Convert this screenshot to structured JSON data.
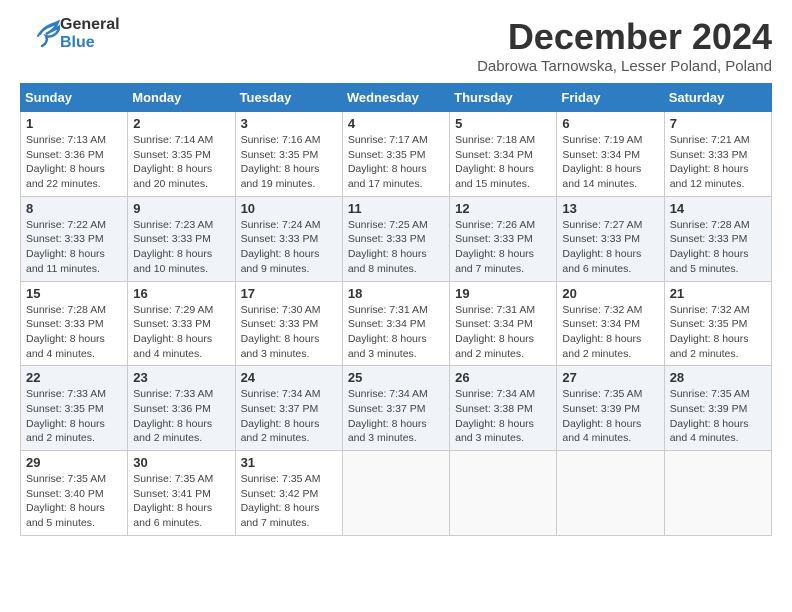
{
  "header": {
    "logo_general": "General",
    "logo_blue": "Blue",
    "month_title": "December 2024",
    "subtitle": "Dabrowa Tarnowska, Lesser Poland, Poland"
  },
  "days_of_week": [
    "Sunday",
    "Monday",
    "Tuesday",
    "Wednesday",
    "Thursday",
    "Friday",
    "Saturday"
  ],
  "weeks": [
    [
      {
        "day": "1",
        "sunrise": "7:13 AM",
        "sunset": "3:36 PM",
        "daylight": "8 hours and 22 minutes."
      },
      {
        "day": "2",
        "sunrise": "7:14 AM",
        "sunset": "3:35 PM",
        "daylight": "8 hours and 20 minutes."
      },
      {
        "day": "3",
        "sunrise": "7:16 AM",
        "sunset": "3:35 PM",
        "daylight": "8 hours and 19 minutes."
      },
      {
        "day": "4",
        "sunrise": "7:17 AM",
        "sunset": "3:35 PM",
        "daylight": "8 hours and 17 minutes."
      },
      {
        "day": "5",
        "sunrise": "7:18 AM",
        "sunset": "3:34 PM",
        "daylight": "8 hours and 15 minutes."
      },
      {
        "day": "6",
        "sunrise": "7:19 AM",
        "sunset": "3:34 PM",
        "daylight": "8 hours and 14 minutes."
      },
      {
        "day": "7",
        "sunrise": "7:21 AM",
        "sunset": "3:33 PM",
        "daylight": "8 hours and 12 minutes."
      }
    ],
    [
      {
        "day": "8",
        "sunrise": "7:22 AM",
        "sunset": "3:33 PM",
        "daylight": "8 hours and 11 minutes."
      },
      {
        "day": "9",
        "sunrise": "7:23 AM",
        "sunset": "3:33 PM",
        "daylight": "8 hours and 10 minutes."
      },
      {
        "day": "10",
        "sunrise": "7:24 AM",
        "sunset": "3:33 PM",
        "daylight": "8 hours and 9 minutes."
      },
      {
        "day": "11",
        "sunrise": "7:25 AM",
        "sunset": "3:33 PM",
        "daylight": "8 hours and 8 minutes."
      },
      {
        "day": "12",
        "sunrise": "7:26 AM",
        "sunset": "3:33 PM",
        "daylight": "8 hours and 7 minutes."
      },
      {
        "day": "13",
        "sunrise": "7:27 AM",
        "sunset": "3:33 PM",
        "daylight": "8 hours and 6 minutes."
      },
      {
        "day": "14",
        "sunrise": "7:28 AM",
        "sunset": "3:33 PM",
        "daylight": "8 hours and 5 minutes."
      }
    ],
    [
      {
        "day": "15",
        "sunrise": "7:28 AM",
        "sunset": "3:33 PM",
        "daylight": "8 hours and 4 minutes."
      },
      {
        "day": "16",
        "sunrise": "7:29 AM",
        "sunset": "3:33 PM",
        "daylight": "8 hours and 4 minutes."
      },
      {
        "day": "17",
        "sunrise": "7:30 AM",
        "sunset": "3:33 PM",
        "daylight": "8 hours and 3 minutes."
      },
      {
        "day": "18",
        "sunrise": "7:31 AM",
        "sunset": "3:34 PM",
        "daylight": "8 hours and 3 minutes."
      },
      {
        "day": "19",
        "sunrise": "7:31 AM",
        "sunset": "3:34 PM",
        "daylight": "8 hours and 2 minutes."
      },
      {
        "day": "20",
        "sunrise": "7:32 AM",
        "sunset": "3:34 PM",
        "daylight": "8 hours and 2 minutes."
      },
      {
        "day": "21",
        "sunrise": "7:32 AM",
        "sunset": "3:35 PM",
        "daylight": "8 hours and 2 minutes."
      }
    ],
    [
      {
        "day": "22",
        "sunrise": "7:33 AM",
        "sunset": "3:35 PM",
        "daylight": "8 hours and 2 minutes."
      },
      {
        "day": "23",
        "sunrise": "7:33 AM",
        "sunset": "3:36 PM",
        "daylight": "8 hours and 2 minutes."
      },
      {
        "day": "24",
        "sunrise": "7:34 AM",
        "sunset": "3:37 PM",
        "daylight": "8 hours and 2 minutes."
      },
      {
        "day": "25",
        "sunrise": "7:34 AM",
        "sunset": "3:37 PM",
        "daylight": "8 hours and 3 minutes."
      },
      {
        "day": "26",
        "sunrise": "7:34 AM",
        "sunset": "3:38 PM",
        "daylight": "8 hours and 3 minutes."
      },
      {
        "day": "27",
        "sunrise": "7:35 AM",
        "sunset": "3:39 PM",
        "daylight": "8 hours and 4 minutes."
      },
      {
        "day": "28",
        "sunrise": "7:35 AM",
        "sunset": "3:39 PM",
        "daylight": "8 hours and 4 minutes."
      }
    ],
    [
      {
        "day": "29",
        "sunrise": "7:35 AM",
        "sunset": "3:40 PM",
        "daylight": "8 hours and 5 minutes."
      },
      {
        "day": "30",
        "sunrise": "7:35 AM",
        "sunset": "3:41 PM",
        "daylight": "8 hours and 6 minutes."
      },
      {
        "day": "31",
        "sunrise": "7:35 AM",
        "sunset": "3:42 PM",
        "daylight": "8 hours and 7 minutes."
      },
      null,
      null,
      null,
      null
    ]
  ],
  "labels": {
    "sunrise": "Sunrise:",
    "sunset": "Sunset:",
    "daylight": "Daylight:"
  }
}
